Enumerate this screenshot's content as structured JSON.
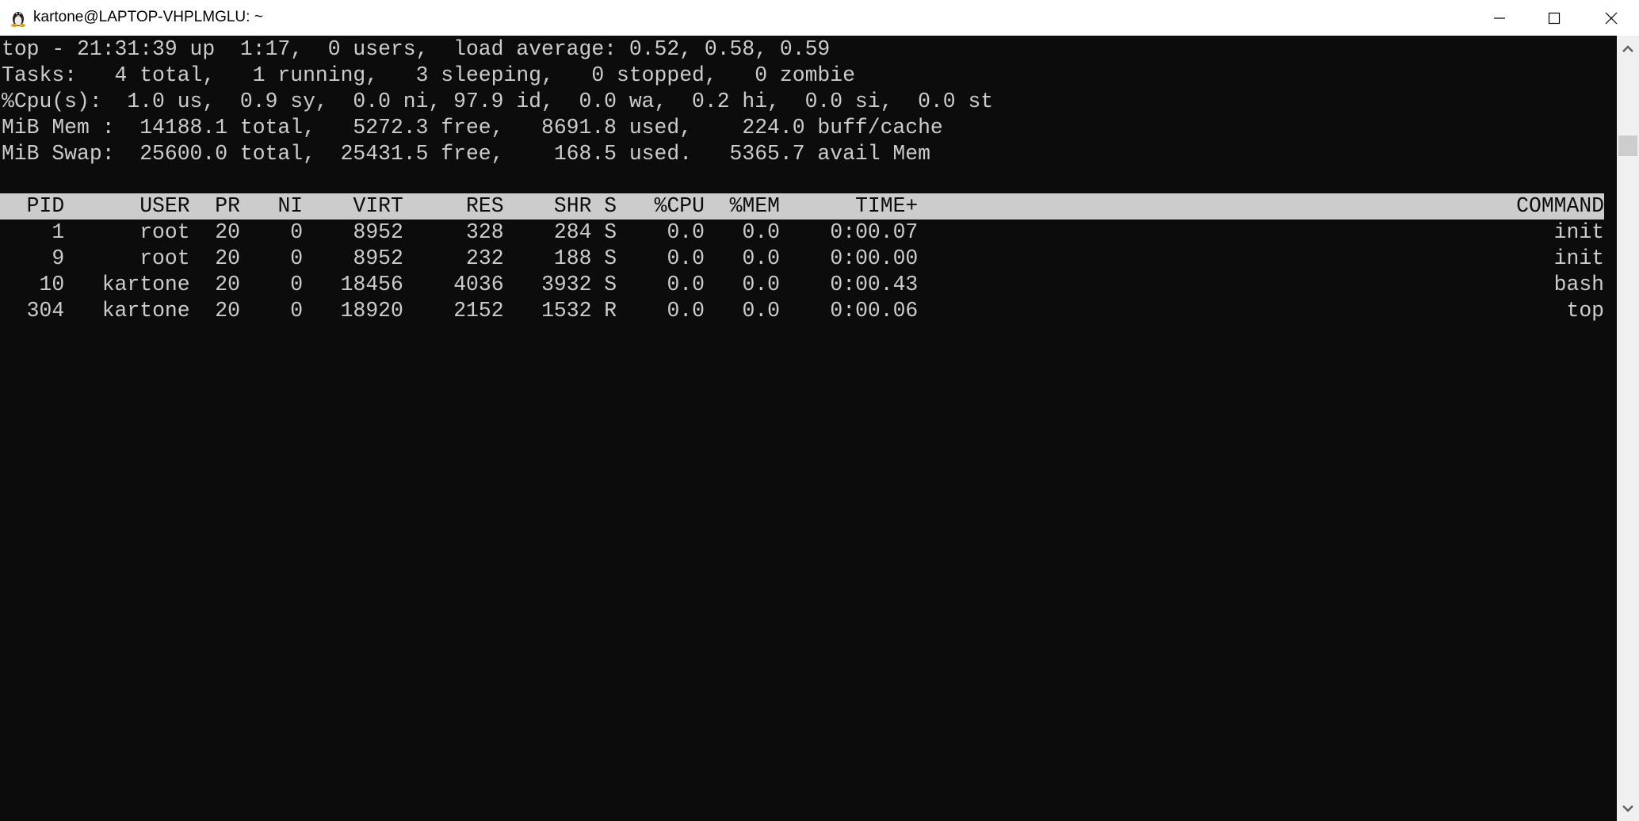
{
  "window": {
    "title": "kartone@LAPTOP-VHPLMGLU: ~",
    "icon": "linux-penguin-icon",
    "controls": [
      "minimize-icon",
      "maximize-icon",
      "close-icon"
    ]
  },
  "colors": {
    "background": "#0c0c0c",
    "foreground": "#cccccc",
    "header_bg": "#cccccc"
  },
  "summary": [
    "top - 21:31:39 up  1:17,  0 users,  load average: 0.52, 0.58, 0.59",
    "Tasks:   4 total,   1 running,   3 sleeping,   0 stopped,   0 zombie",
    "%Cpu(s):  1.0 us,  0.9 sy,  0.0 ni, 97.9 id,  0.0 wa,  0.2 hi,  0.0 si,  0.0 st",
    "MiB Mem :  14188.1 total,   5272.3 free,   8691.8 used,    224.0 buff/cache",
    "MiB Swap:  25600.0 total,  25431.5 free,    168.5 used.   5365.7 avail Mem"
  ],
  "table": {
    "columns": [
      "PID",
      "USER",
      "PR",
      "NI",
      "VIRT",
      "RES",
      "SHR",
      "S",
      "%CPU",
      "%MEM",
      "TIME+",
      "COMMAND"
    ],
    "rows": [
      [
        "1",
        "root",
        "20",
        "0",
        "8952",
        "328",
        "284",
        "S",
        "0.0",
        "0.0",
        "0:00.07",
        "init"
      ],
      [
        "9",
        "root",
        "20",
        "0",
        "8952",
        "232",
        "188",
        "S",
        "0.0",
        "0.0",
        "0:00.00",
        "init"
      ],
      [
        "10",
        "kartone",
        "20",
        "0",
        "18456",
        "4036",
        "3932",
        "S",
        "0.0",
        "0.0",
        "0:00.43",
        "bash"
      ],
      [
        "304",
        "kartone",
        "20",
        "0",
        "18920",
        "2152",
        "1532",
        "R",
        "0.0",
        "0.0",
        "0:00.06",
        "top"
      ]
    ]
  }
}
